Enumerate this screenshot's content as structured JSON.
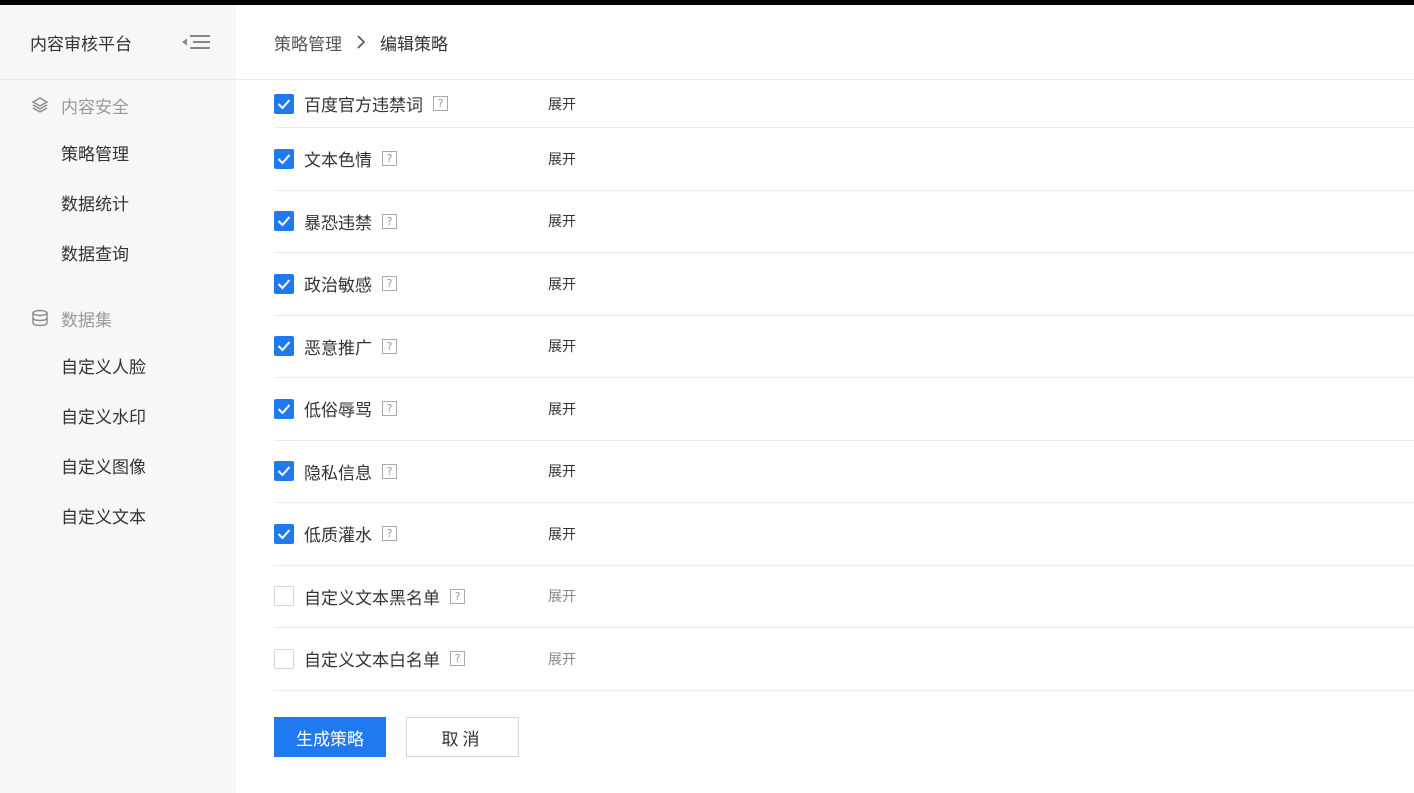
{
  "app": {
    "title": "内容审核平台"
  },
  "sidebar": {
    "groups": [
      {
        "label": "内容安全",
        "icon": "layers-icon",
        "items": [
          {
            "label": "策略管理"
          },
          {
            "label": "数据统计"
          },
          {
            "label": "数据查询"
          }
        ]
      },
      {
        "label": "数据集",
        "icon": "database-icon",
        "items": [
          {
            "label": "自定义人脸"
          },
          {
            "label": "自定义水印"
          },
          {
            "label": "自定义图像"
          },
          {
            "label": "自定义文本"
          }
        ]
      }
    ]
  },
  "breadcrumb": {
    "parent": "策略管理",
    "current": "编辑策略"
  },
  "rules": [
    {
      "label": "百度官方违禁词",
      "checked": true,
      "expand": "展开"
    },
    {
      "label": "文本色情",
      "checked": true,
      "expand": "展开"
    },
    {
      "label": "暴恐违禁",
      "checked": true,
      "expand": "展开"
    },
    {
      "label": "政治敏感",
      "checked": true,
      "expand": "展开"
    },
    {
      "label": "恶意推广",
      "checked": true,
      "expand": "展开"
    },
    {
      "label": "低俗辱骂",
      "checked": true,
      "expand": "展开"
    },
    {
      "label": "隐私信息",
      "checked": true,
      "expand": "展开"
    },
    {
      "label": "低质灌水",
      "checked": true,
      "expand": "展开"
    },
    {
      "label": "自定义文本黑名单",
      "checked": false,
      "expand": "展开"
    },
    {
      "label": "自定义文本白名单",
      "checked": false,
      "expand": "展开"
    }
  ],
  "help_glyph": "?",
  "actions": {
    "submit": "生成策略",
    "cancel": "取消"
  },
  "colors": {
    "primary": "#1f79f0",
    "sidebar_bg": "#f7f7f7",
    "border": "#ececec"
  }
}
